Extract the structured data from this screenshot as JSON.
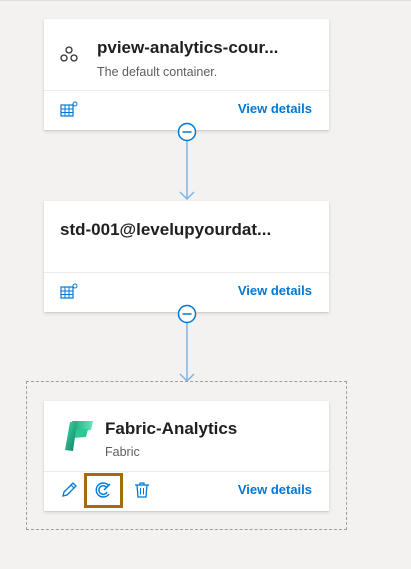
{
  "cards": [
    {
      "title": "pview-analytics-cour...",
      "subtitle": "The default container.",
      "view_details_label": "View details",
      "icon": "collection-icon",
      "footer_icon": "table-settings-icon"
    },
    {
      "title": "std-001@levelupyourdat...",
      "view_details_label": "View details",
      "footer_icon": "table-settings-icon"
    },
    {
      "title": "Fabric-Analytics",
      "subtitle": "Fabric",
      "view_details_label": "View details",
      "icon": "fabric-logo",
      "footer_icons": [
        "edit-icon",
        "scan-icon",
        "delete-icon"
      ]
    }
  ],
  "colors": {
    "accent": "#0078d4",
    "connector": "#7fb5e6",
    "highlight": "#a66a12",
    "card_background": "#ffffff",
    "canvas_background": "#f3f2f1"
  }
}
